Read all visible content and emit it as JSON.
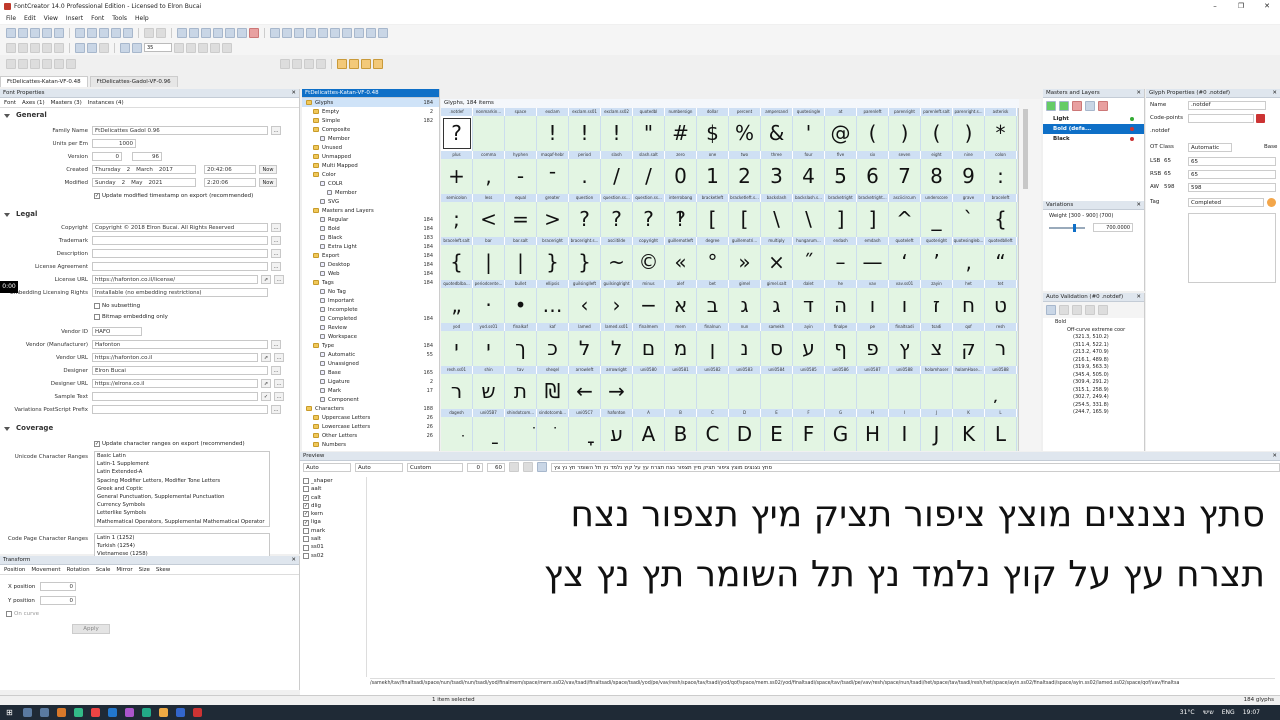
{
  "app": {
    "title": "FontCreator 14.0 Professional Edition - Licensed to Elron Bucai"
  },
  "menu": [
    "File",
    "Edit",
    "View",
    "Insert",
    "Font",
    "Tools",
    "Help"
  ],
  "toolbar": {
    "zoom_value": "35"
  },
  "doc_tabs": [
    "FtDelicattes-Katan-VF-0.48",
    "FtDelicattes-Gadol-VF-0.96"
  ],
  "font_properties": {
    "title": "Font Properties",
    "tabs": [
      "Font",
      "Axes (1)",
      "Masters (3)",
      "Instances (4)"
    ],
    "general": {
      "heading": "General",
      "family_name_label": "Family Name",
      "family_name": "FtDelicattes Gadol 0.96",
      "units_label": "Units per Em",
      "units": "1000",
      "version_label": "Version",
      "version_major": "0",
      "version_minor": "96",
      "created_label": "Created",
      "created_day": "Thursday",
      "created_d": "2",
      "created_month": "March",
      "created_year": "2017",
      "created_time": "20:42:06",
      "modified_label": "Modified",
      "modified_day": "Sunday",
      "modified_d": "2",
      "modified_month": "May",
      "modified_year": "2021",
      "modified_time": "2:20:06",
      "now": "Now",
      "update_timestamp": "Update modified timestamp on export (recommended)"
    },
    "legal": {
      "heading": "Legal",
      "copyright_label": "Copyright",
      "copyright": "Copyright © 2018 Elron Bucai. All Rights Reserved",
      "trademark_label": "Trademark",
      "description_label": "Description",
      "license_agreement_label": "License Agreement",
      "license_url_label": "License URL",
      "license_url": "https://hafonton.co.il/license/",
      "embedding_label": "Embedding Licensing Rights",
      "embedding": "Installable (no embedding restrictions)",
      "no_subsetting": "No subsetting",
      "bitmap_only": "Bitmap embedding only",
      "vendor_id_label": "Vendor ID",
      "vendor_id": "HAFO",
      "vendor_manuf_label": "Vendor (Manufacturer)",
      "vendor_manuf": "Hafonton",
      "vendor_url_label": "Vendor URL",
      "vendor_url": "https://hafonton.co.il",
      "designer_label": "Designer",
      "designer": "Elron Bucai",
      "designer_url_label": "Designer URL",
      "designer_url": "https://elrons.co.il",
      "sample_text_label": "Sample Text",
      "variations_ps_label": "Variations PostScript Prefix"
    },
    "coverage": {
      "heading": "Coverage",
      "update_ranges": "Update character ranges on export (recommended)",
      "unicode_label": "Unicode Character Ranges",
      "unicode_ranges": [
        "Basic Latin",
        "Latin-1 Supplement",
        "Latin Extended-A",
        "Spacing Modifier Letters, Modifier Tone Letters",
        "Greek and Coptic",
        "General Punctuation, Supplemental Punctuation",
        "Currency Symbols",
        "Letterlike Symbols",
        "Mathematical Operators, Supplemental Mathematical Operator"
      ],
      "codepage_label": "Code Page Character Ranges",
      "codepage_ranges": [
        "Latin 1 (1252)",
        "Turkish (1254)",
        "Vietnamese (1258)"
      ]
    }
  },
  "transforms": {
    "title": "Transform",
    "tabs": [
      "Position",
      "Movement",
      "Rotation",
      "Scale",
      "Mirror",
      "Size",
      "Skew"
    ],
    "x_label": "X position",
    "x": "0",
    "y_label": "Y position",
    "y": "0",
    "on_curve": "On curve",
    "apply": "Apply"
  },
  "timer": "0:00",
  "tree": {
    "title": "FtDelicattes-Katan-VF-0.48",
    "items": [
      {
        "label": "Glyphs",
        "count": "184",
        "level": 0,
        "selected": true
      },
      {
        "label": "Empty",
        "count": "2",
        "level": 1
      },
      {
        "label": "Simple",
        "count": "182",
        "level": 1
      },
      {
        "label": "Composite",
        "count": "",
        "level": 1
      },
      {
        "label": "Member",
        "count": "",
        "level": 2
      },
      {
        "label": "Unused",
        "count": "",
        "level": 1
      },
      {
        "label": "Unmapped",
        "count": "",
        "level": 1
      },
      {
        "label": "Multi Mapped",
        "count": "",
        "level": 1
      },
      {
        "label": "Color",
        "count": "",
        "level": 1
      },
      {
        "label": "COLR",
        "count": "",
        "level": 2
      },
      {
        "label": "Member",
        "count": "",
        "level": 3
      },
      {
        "label": "SVG",
        "count": "",
        "level": 2
      },
      {
        "label": "Masters and Layers",
        "count": "",
        "level": 1
      },
      {
        "label": "Regular",
        "count": "184",
        "level": 2
      },
      {
        "label": "Bold",
        "count": "184",
        "level": 2
      },
      {
        "label": "Black",
        "count": "183",
        "level": 2
      },
      {
        "label": "Extra Light",
        "count": "184",
        "level": 2
      },
      {
        "label": "Export",
        "count": "184",
        "level": 1
      },
      {
        "label": "Desktop",
        "count": "184",
        "level": 2
      },
      {
        "label": "Web",
        "count": "184",
        "level": 2
      },
      {
        "label": "Tags",
        "count": "184",
        "level": 1
      },
      {
        "label": "No Tag",
        "count": "",
        "level": 2
      },
      {
        "label": "Important",
        "count": "",
        "level": 2
      },
      {
        "label": "Incomplete",
        "count": "",
        "level": 2
      },
      {
        "label": "Completed",
        "count": "184",
        "level": 2
      },
      {
        "label": "Review",
        "count": "",
        "level": 2
      },
      {
        "label": "Workspace",
        "count": "",
        "level": 2
      },
      {
        "label": "Type",
        "count": "184",
        "level": 1
      },
      {
        "label": "Automatic",
        "count": "55",
        "level": 2
      },
      {
        "label": "Unassigned",
        "count": "",
        "level": 2
      },
      {
        "label": "Base",
        "count": "165",
        "level": 2
      },
      {
        "label": "Ligature",
        "count": "2",
        "level": 2
      },
      {
        "label": "Mark",
        "count": "17",
        "level": 2
      },
      {
        "label": "Component",
        "count": "",
        "level": 2
      },
      {
        "label": "Characters",
        "count": "188",
        "level": 0
      },
      {
        "label": "Uppercase Letters",
        "count": "26",
        "level": 1
      },
      {
        "label": "Lowercase Letters",
        "count": "26",
        "level": 1
      },
      {
        "label": "Other Letters",
        "count": "26",
        "level": 1
      },
      {
        "label": "Numbers",
        "count": "",
        "level": 1
      }
    ]
  },
  "glyph_grid": {
    "header": "Glyphs, 184 items",
    "rows": [
      {
        "names": [
          ".notdef",
          "nonmarkin...",
          "space",
          "exclam",
          "exclam.ss01",
          "exclam.ss02",
          "quotedbl",
          "numbersign",
          "dollar",
          "percent",
          "ampersand",
          "quotesingle",
          "at",
          "parenleft",
          "parenright",
          "parenleft.salt",
          "parenright.s...",
          "asterisk"
        ],
        "glyphs": [
          "?",
          "",
          "",
          "!",
          "!",
          "!",
          "\"",
          "#",
          "$",
          "%",
          "&",
          "'",
          "@",
          "(",
          ")",
          "(",
          ")",
          "*"
        ]
      },
      {
        "names": [
          "plus",
          "comma",
          "hyphen",
          "maqaf-hebr",
          "period",
          "slash",
          "slash.salt",
          "zero",
          "one",
          "two",
          "three",
          "four",
          "five",
          "six",
          "seven",
          "eight",
          "nine",
          "colon"
        ],
        "glyphs": [
          "+",
          ",",
          "-",
          "־",
          ".",
          "/",
          "/",
          "0",
          "1",
          "2",
          "3",
          "4",
          "5",
          "6",
          "7",
          "8",
          "9",
          ":"
        ]
      },
      {
        "names": [
          "semicolon",
          "less",
          "equal",
          "greater",
          "question",
          "question.ss...",
          "question.ss...",
          "interrobang",
          "bracketleft",
          "bracketleft.s...",
          "backslash",
          "backslash.s...",
          "bracketright",
          "bracketright...",
          "asciicircum",
          "underscore",
          "grave",
          "braceleft"
        ],
        "glyphs": [
          ";",
          "<",
          "=",
          ">",
          "?",
          "?",
          "?",
          "‽",
          "[",
          "[",
          "\\",
          "\\",
          "]",
          "]",
          "^",
          "_",
          "`",
          "{"
        ]
      },
      {
        "names": [
          "braceleft.salt",
          "bar",
          "bar.salt",
          "braceright",
          "braceright.s...",
          "asciitilde",
          "copyright",
          "guillemotleft",
          "degree",
          "guillemotri...",
          "multiply",
          "hungarum...",
          "endash",
          "emdash",
          "quoteleft",
          "quoteright",
          "quotesingleb...",
          "quotedblleft"
        ],
        "glyphs": [
          "{",
          "|",
          "|",
          "}",
          "}",
          "~",
          "©",
          "«",
          "°",
          "»",
          "×",
          "˝",
          "–",
          "—",
          "‘",
          "’",
          "‚",
          "“"
        ]
      },
      {
        "names": [
          "quotedblba...",
          "periodcente...",
          "bullet",
          "ellipsis",
          "guilsinglleft",
          "guilsinglright",
          "minus",
          "alef",
          "bet",
          "gimel",
          "gimel.salt",
          "dalet",
          "he",
          "vav",
          "vav.ss01",
          "zayin",
          "het",
          "tet"
        ],
        "glyphs": [
          "„",
          "·",
          "•",
          "…",
          "‹",
          "›",
          "−",
          "א",
          "ב",
          "ג",
          "ג",
          "ד",
          "ה",
          "ו",
          "ו",
          "ז",
          "ח",
          "ט"
        ]
      },
      {
        "names": [
          "yod",
          "yod.ss01",
          "finalkaf",
          "kaf",
          "lamed",
          "lamed.ss01",
          "finalmem",
          "mem",
          "finalnun",
          "nun",
          "samekh",
          "ayin",
          "finalpe",
          "pe",
          "finaltsadi",
          "tsadi",
          "qof",
          "resh"
        ],
        "glyphs": [
          "י",
          "י",
          "ך",
          "כ",
          "ל",
          "ל",
          "ם",
          "מ",
          "ן",
          "נ",
          "ס",
          "ע",
          "ף",
          "פ",
          "ץ",
          "צ",
          "ק",
          "ר"
        ]
      },
      {
        "names": [
          "resh.ss01",
          "shin",
          "tav",
          "sheqel",
          "arrowleft",
          "arrowright",
          "uni0580",
          "uni0581",
          "uni0582",
          "uni0583",
          "uni0584",
          "uni0585",
          "uni0586",
          "uni0587",
          "uni0588",
          "holamhaser",
          "holamHase...",
          "uni0588"
        ],
        "glyphs": [
          "ר",
          "ש",
          "ת",
          "₪",
          "←",
          "→",
          "",
          "",
          "",
          "",
          "",
          "",
          "",
          "",
          "",
          "",
          "",
          "̦"
        ]
      },
      {
        "names": [
          "dagesh",
          "uni05B7",
          "shindotcom...",
          "sindotcomb...",
          "uni05C7",
          "hafonton",
          "A",
          "B",
          "C",
          "D",
          "E",
          "F",
          "G",
          "H",
          "I",
          "J",
          "K",
          "L"
        ],
        "glyphs": [
          "ּ",
          "ַ",
          "ׁ",
          "ׂ",
          "ׇ",
          "ﬠ",
          "A",
          "B",
          "C",
          "D",
          "E",
          "F",
          "G",
          "H",
          "I",
          "J",
          "K",
          "L"
        ]
      }
    ]
  },
  "masters": {
    "title": "Masters and Layers",
    "items": [
      "Light",
      "Bold (defa...",
      "Black"
    ]
  },
  "variations": {
    "title": "Variations",
    "weight_label": "Weight [300 - 900] (700)",
    "weight_value": "700.0000",
    "slider_fraction": 0.67
  },
  "auto_validation": {
    "title": "Auto Validation (#0 .notdef)",
    "group": "Bold",
    "subgroup": "Off-curve extreme coor",
    "items": [
      "(321.3, 510.2)",
      "(311.4, 522.1)",
      "(213.2, 470.9)",
      "(216.1, 489.8)",
      "(319.9, 563.3)",
      "(345.4, 505.0)",
      "(309.4, 291.2)",
      "(315.1, 258.9)",
      "(302.7, 249.4)",
      "(254.5, 331.8)",
      "(244.7, 165.9)"
    ]
  },
  "glyph_props": {
    "title": "Glyph Properties (#0 .notdef)",
    "name_label": "Name",
    "name": ".notdef",
    "codepoints_label": "Code-points",
    "name2": ".notdef",
    "ot_class_label": "OT Class",
    "ot_class": "Automatic",
    "base_label": "Base",
    "lsb_label": "LSB",
    "lsb_a": "65",
    "lsb_b": "65",
    "rsb_label": "RSB",
    "rsb_a": "65",
    "rsb_b": "65",
    "aw_label": "AW",
    "aw_a": "598",
    "aw_b": "598",
    "tag_label": "Tag",
    "tag": "Completed"
  },
  "preview": {
    "title": "Preview",
    "dd1": "Auto",
    "dd2": "Auto",
    "dd3": "Custom",
    "num1": "0",
    "num2": "60",
    "input_text": "סתץ נצנצים מוצץ ציפור תציק מיץ תצפור נצח תצרח עץ על קוץ נלמד נץ תל השומר תץ נץ צץ",
    "features": [
      "_shaper",
      "aalt",
      "calt",
      "dlig",
      "kern",
      "liga",
      "mark",
      "salt",
      "ss01",
      "ss02"
    ],
    "features_checked": [
      false,
      false,
      true,
      true,
      true,
      true,
      false,
      false,
      false,
      false
    ],
    "line1": "סתץ נצנצים מוצץ ציפור תציק מיץ תצפור נצח",
    "line2": "תצרח עץ על קוץ נלמד נץ תל השומר תץ נץ צץ",
    "glyph_string": "/samekh/tav/finaltsadi/space/nun/tsadi/nun/tsadi/yod/finalmem/space/mem.ss02/vav/tsadi/finaltsadi/space/tsadi/yod/pe/vav/resh/space/tav/tsadi/yod/qof/space/mem.ss02/yod/finaltsadi/space/tav/tsadi/pe/vav/resh/space/nun/tsadi/het/space/tav/tsadi/resh/het/space/ayin.ss02/finaltsadi/space/ayin.ss02/lamed.ss02/space/qof/vav/finaltsa"
  },
  "status": {
    "selected": "1 item selected",
    "count": "184 glyphs"
  },
  "taskbar": {
    "temp": "31°C",
    "lang": "ENG",
    "time": "19:07",
    "day": "שישי"
  }
}
